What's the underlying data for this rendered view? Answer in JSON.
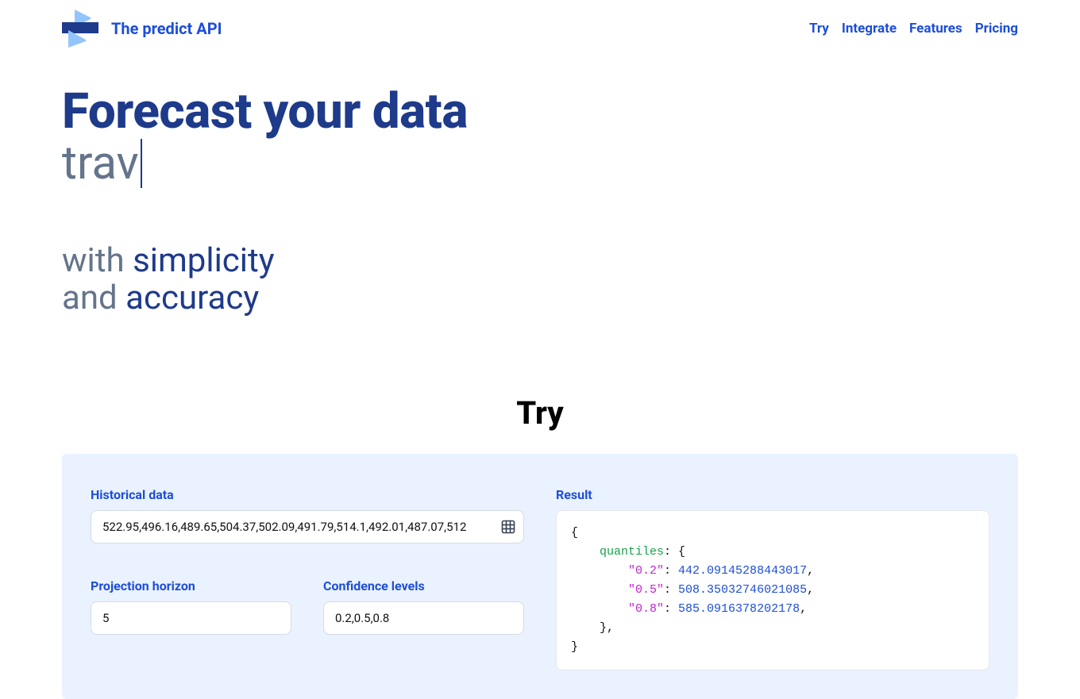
{
  "header": {
    "brand": "The predict API",
    "nav": [
      "Try",
      "Integrate",
      "Features",
      "Pricing"
    ]
  },
  "hero": {
    "headline": "Forecast your data",
    "typing": "trav",
    "sub_with": "with",
    "sub_simplicity": "simplicity",
    "sub_and": "and",
    "sub_accuracy": "accuracy"
  },
  "section": {
    "try_heading": "Try"
  },
  "try": {
    "historical_label": "Historical data",
    "historical_value": "522.95,496.16,489.65,504.37,502.09,491.79,514.1,492.01,487.07,512",
    "horizon_label": "Projection horizon",
    "horizon_value": "5",
    "confidence_label": "Confidence levels",
    "confidence_value": "0.2,0.5,0.8",
    "result_label": "Result",
    "result": {
      "quantiles_key": "quantiles",
      "q02_key": "\"0.2\"",
      "q02_val": "442.09145288443017",
      "q05_key": "\"0.5\"",
      "q05_val": "508.35032746021085",
      "q08_key": "\"0.8\"",
      "q08_val": "585.0916378202178"
    }
  }
}
